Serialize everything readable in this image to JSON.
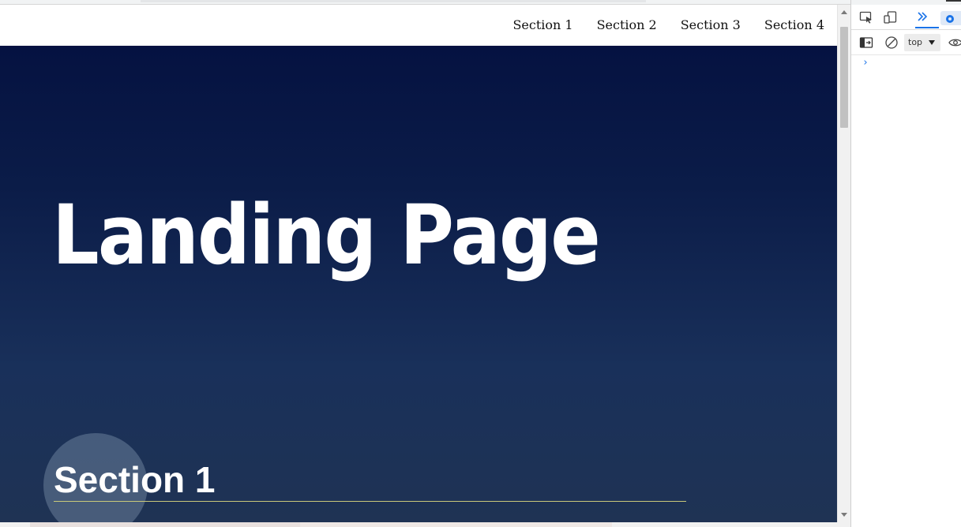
{
  "nav": {
    "links": [
      {
        "label": "Section 1"
      },
      {
        "label": "Section 2"
      },
      {
        "label": "Section 3"
      },
      {
        "label": "Section 4"
      }
    ]
  },
  "hero": {
    "title": "Landing Page"
  },
  "section1": {
    "heading": "Section 1"
  },
  "devtools": {
    "context_label": "top",
    "prompt_symbol": "›",
    "icons": [
      "inspect-element-icon",
      "device-toggle-icon",
      "more-tabs-icon",
      "issues-badge-icon",
      "sidebar-toggle-icon",
      "clear-console-icon",
      "eye-icon"
    ]
  },
  "colors": {
    "hero_top": "#030f3f",
    "hero_bottom": "#1f3354",
    "section_rule": "#c9c97a",
    "devtools_accent": "#1a73e8"
  }
}
